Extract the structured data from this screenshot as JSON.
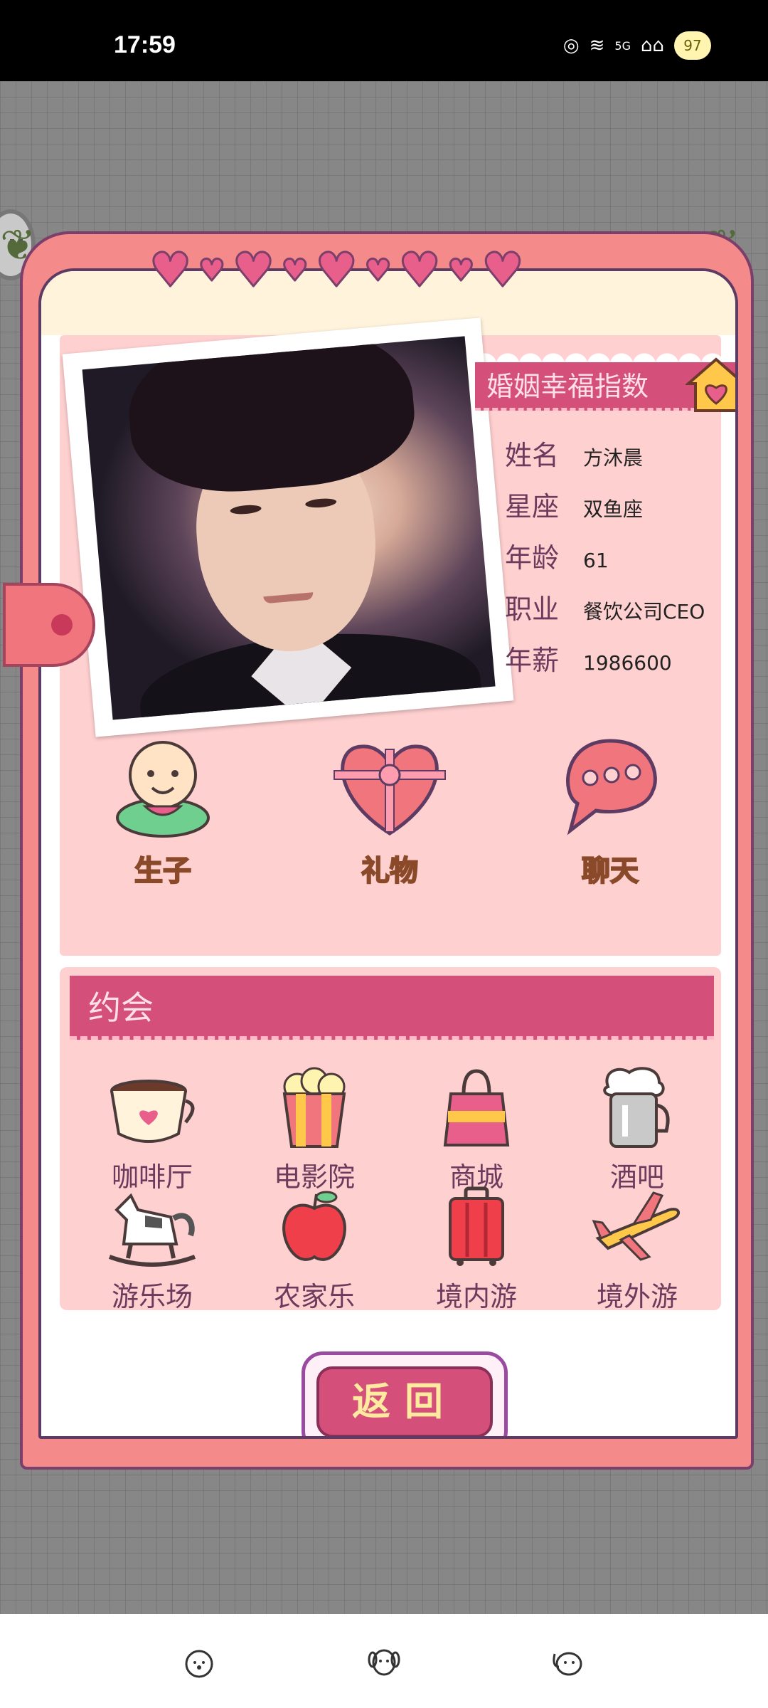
{
  "status_bar": {
    "time": "17:59",
    "signal_label": "5G",
    "battery": "97"
  },
  "card": {
    "title": "婚姻幸福指数",
    "fields": [
      {
        "label": "姓名",
        "value": "方沐晨"
      },
      {
        "label": "星座",
        "value": "双鱼座"
      },
      {
        "label": "年龄",
        "value": "61"
      },
      {
        "label": "职业",
        "value": "餐饮公司CEO"
      },
      {
        "label": "年薪",
        "value": "1986600"
      }
    ],
    "actions": [
      {
        "label": "生子",
        "icon": "baby-icon"
      },
      {
        "label": "礼物",
        "icon": "gift-heart-icon"
      },
      {
        "label": "聊天",
        "icon": "chat-bubble-icon"
      }
    ]
  },
  "date": {
    "title": "约会",
    "venues": [
      {
        "label": "咖啡厅",
        "icon": "coffee-cup-icon"
      },
      {
        "label": "电影院",
        "icon": "popcorn-icon"
      },
      {
        "label": "商城",
        "icon": "shopping-bag-icon"
      },
      {
        "label": "酒吧",
        "icon": "beer-mug-icon"
      },
      {
        "label": "游乐场",
        "icon": "rocking-horse-icon"
      },
      {
        "label": "农家乐",
        "icon": "apple-icon"
      },
      {
        "label": "境内游",
        "icon": "suitcase-icon"
      },
      {
        "label": "境外游",
        "icon": "airplane-icon"
      }
    ]
  },
  "back_button": "返回",
  "colors": {
    "modal": "#f58a8a",
    "panel": "#ffd0d0",
    "header": "#d44f7a",
    "accent": "#ffc84a"
  }
}
